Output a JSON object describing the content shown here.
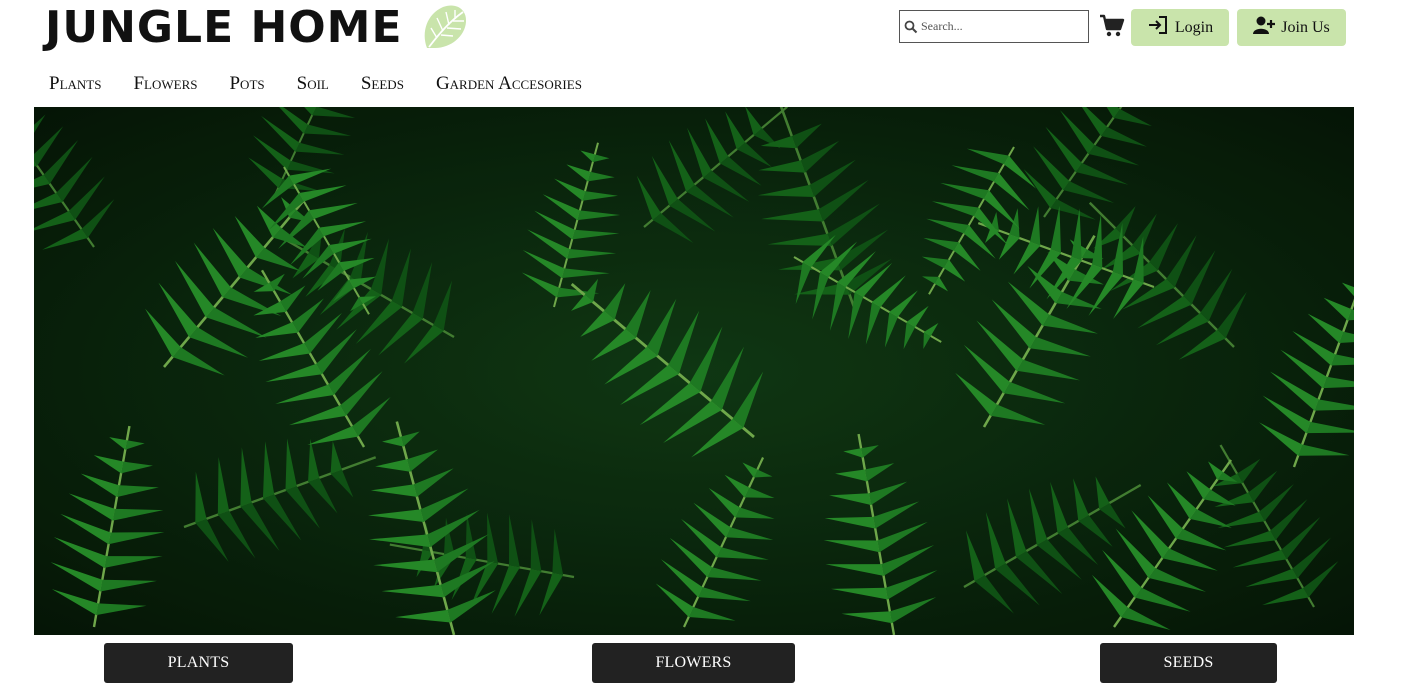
{
  "brand": {
    "name": "JUNGLE HOME",
    "leaf_icon": "monstera-leaf-icon",
    "leaf_color": "#c9e4ab"
  },
  "search": {
    "placeholder": "Search...",
    "value": "",
    "icon": "search-icon"
  },
  "cart": {
    "icon": "shopping-cart-icon"
  },
  "auth": {
    "login_label": "Login",
    "login_icon": "sign-in-icon",
    "join_label": "Join Us",
    "join_icon": "user-plus-icon",
    "button_color": "#c9e4ab"
  },
  "nav": {
    "items": [
      {
        "label": "Plants"
      },
      {
        "label": "Flowers"
      },
      {
        "label": "Pots"
      },
      {
        "label": "Soil"
      },
      {
        "label": "Seeds"
      },
      {
        "label": "Garden Accesories"
      }
    ]
  },
  "hero": {
    "subject": "fern-leaves-image",
    "dominant_color": "#1e7d24"
  },
  "categories": {
    "items": [
      {
        "label": "PLANTS"
      },
      {
        "label": "FLOWERS"
      },
      {
        "label": "SEEDS"
      }
    ],
    "button_color": "#222222"
  }
}
